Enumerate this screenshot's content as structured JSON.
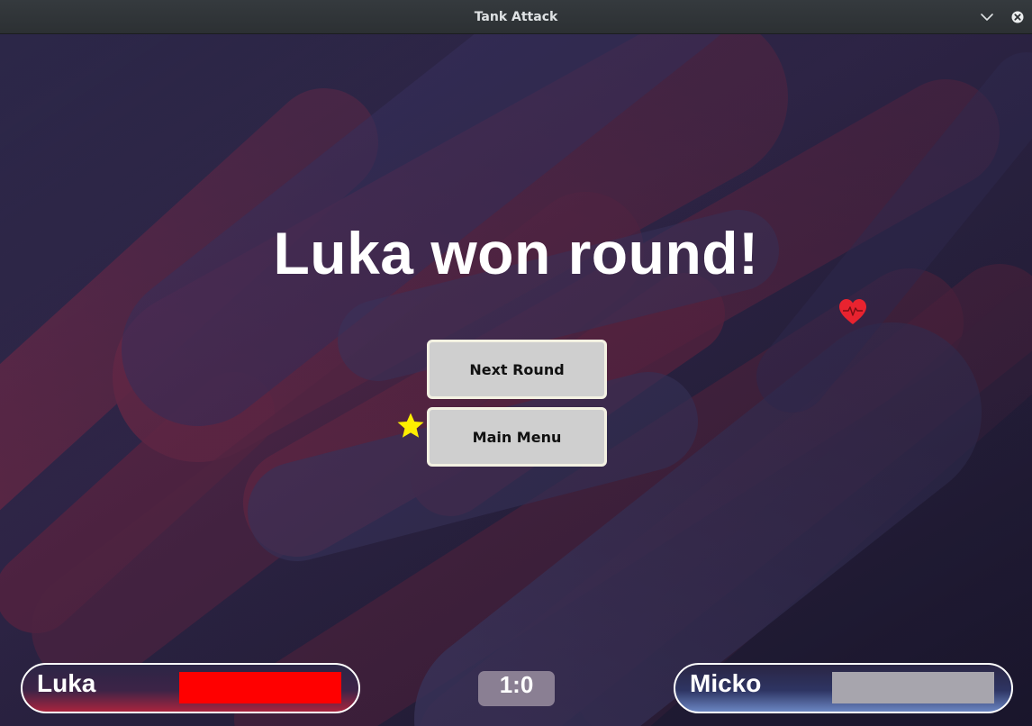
{
  "window": {
    "title": "Tank Attack",
    "minimize_icon": "chevron-down-icon",
    "close_icon": "close-icon"
  },
  "game": {
    "round_message": "Luka won round!",
    "buttons": {
      "next_round": "Next Round",
      "main_menu": "Main Menu"
    },
    "pickups": {
      "star_icon": "star-icon",
      "star_color": "#ffee00",
      "heart_icon": "heart-icon",
      "heart_color": "#e8232f"
    },
    "score": "1:0",
    "players": [
      {
        "name": "Luka",
        "health_fraction": 1.0,
        "health_color": "#ff0000",
        "panel_accent": "#a9243e"
      },
      {
        "name": "Micko",
        "health_fraction": 0.0,
        "health_color": "#ff0000",
        "empty_color": "#a7a5ad",
        "panel_accent": "#6b86c2"
      }
    ]
  }
}
